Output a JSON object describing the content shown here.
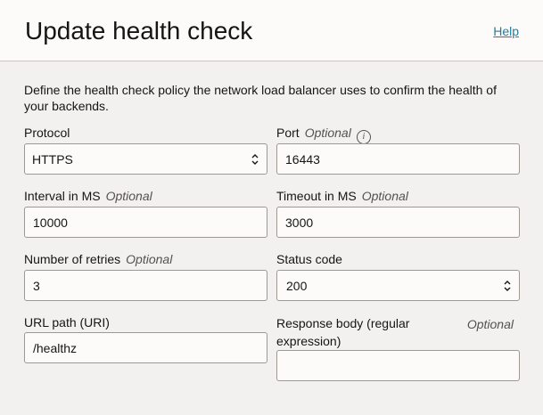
{
  "header": {
    "title": "Update health check",
    "help": "Help"
  },
  "description": "Define the health check policy the network load balancer uses to confirm the health of your backends.",
  "fields": {
    "protocol": {
      "label": "Protocol",
      "value": "HTTPS"
    },
    "port": {
      "label": "Port",
      "optional": "Optional",
      "value": "16443",
      "info_icon": "info-icon"
    },
    "interval": {
      "label": "Interval in MS",
      "optional": "Optional",
      "value": "10000"
    },
    "timeout": {
      "label": "Timeout in MS",
      "optional": "Optional",
      "value": "3000"
    },
    "retries": {
      "label": "Number of retries",
      "optional": "Optional",
      "value": "3"
    },
    "status_code": {
      "label": "Status code",
      "value": "200"
    },
    "url_path": {
      "label": "URL path (URI)",
      "value": "/healthz"
    },
    "response_body": {
      "label": "Response body (regular expression)",
      "optional": "Optional",
      "value": ""
    }
  },
  "colors": {
    "link": "#227e9e",
    "background": "#f2f1ef",
    "header": "#fcfbfa"
  }
}
